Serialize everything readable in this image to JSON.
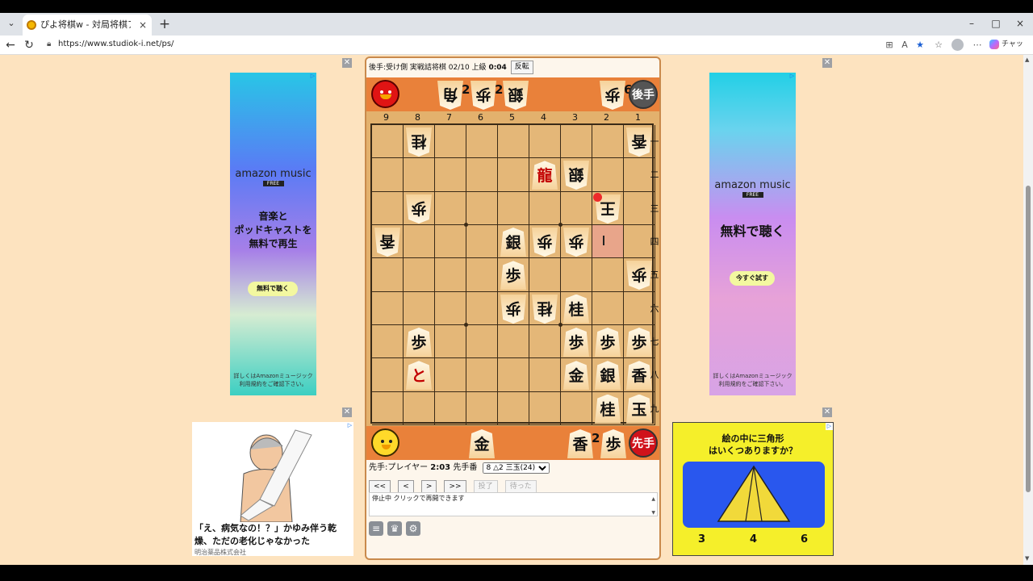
{
  "browser": {
    "tab_title": "ぴよ将棋w - 対局将棋アプリ WEB版",
    "tab_close": "×",
    "new_tab": "+",
    "url": "https://www.studiok-i.net/ps/",
    "copilot_label": "チャット",
    "icons": [
      "tab-list-icon",
      "back-icon",
      "reload-icon",
      "lock-icon",
      "app-icon",
      "read-aloud-icon",
      "favorite-star-icon",
      "favorites-icon",
      "profile-icon",
      "more-icon",
      "copilot-icon"
    ],
    "window_buttons": [
      "–",
      "□",
      "×"
    ]
  },
  "game": {
    "header": {
      "gote_info": "後手:受け側 実戦詰将棋 02/10 上級",
      "gote_time": "0:04",
      "flip_button": "反転"
    },
    "gote_hand": {
      "badge": "後手",
      "pieces": [
        {
          "kanji": "角",
          "count": "2"
        },
        {
          "kanji": "歩",
          "count": "2"
        },
        {
          "kanji": "銀",
          "count": ""
        },
        {
          "kanji": "歩",
          "count": "6"
        }
      ]
    },
    "sente_hand": {
      "badge": "先手",
      "pieces": [
        {
          "kanji": "金",
          "count": ""
        },
        {
          "kanji": "香",
          "count": "2"
        },
        {
          "kanji": "歩",
          "count": ""
        }
      ]
    },
    "files": [
      "9",
      "8",
      "7",
      "6",
      "5",
      "4",
      "3",
      "2",
      "1"
    ],
    "ranks": [
      "一",
      "二",
      "三",
      "四",
      "五",
      "六",
      "七",
      "八",
      "九"
    ],
    "pieces": [
      {
        "file": 8,
        "rank": 1,
        "kanji": "桂",
        "side": "gote"
      },
      {
        "file": 1,
        "rank": 1,
        "kanji": "香",
        "side": "gote"
      },
      {
        "file": 4,
        "rank": 2,
        "kanji": "龍",
        "side": "sente",
        "promoted": true
      },
      {
        "file": 3,
        "rank": 2,
        "kanji": "銀",
        "side": "gote"
      },
      {
        "file": 8,
        "rank": 3,
        "kanji": "歩",
        "side": "gote"
      },
      {
        "file": 2,
        "rank": 3,
        "kanji": "王",
        "side": "gote"
      },
      {
        "file": 9,
        "rank": 4,
        "kanji": "香",
        "side": "gote"
      },
      {
        "file": 5,
        "rank": 4,
        "kanji": "銀",
        "side": "sente"
      },
      {
        "file": 4,
        "rank": 4,
        "kanji": "歩",
        "side": "gote"
      },
      {
        "file": 3,
        "rank": 4,
        "kanji": "歩",
        "side": "gote"
      },
      {
        "file": 5,
        "rank": 5,
        "kanji": "歩",
        "side": "sente"
      },
      {
        "file": 1,
        "rank": 5,
        "kanji": "歩",
        "side": "gote"
      },
      {
        "file": 5,
        "rank": 6,
        "kanji": "歩",
        "side": "gote"
      },
      {
        "file": 4,
        "rank": 6,
        "kanji": "桂",
        "side": "gote"
      },
      {
        "file": 3,
        "rank": 6,
        "kanji": "桂",
        "side": "sente"
      },
      {
        "file": 8,
        "rank": 7,
        "kanji": "歩",
        "side": "sente"
      },
      {
        "file": 3,
        "rank": 7,
        "kanji": "歩",
        "side": "sente"
      },
      {
        "file": 2,
        "rank": 7,
        "kanji": "歩",
        "side": "sente"
      },
      {
        "file": 1,
        "rank": 7,
        "kanji": "歩",
        "side": "sente"
      },
      {
        "file": 8,
        "rank": 8,
        "kanji": "と",
        "side": "sente",
        "promoted": true
      },
      {
        "file": 3,
        "rank": 8,
        "kanji": "金",
        "side": "sente"
      },
      {
        "file": 2,
        "rank": 8,
        "kanji": "銀",
        "side": "sente"
      },
      {
        "file": 1,
        "rank": 8,
        "kanji": "香",
        "side": "sente"
      },
      {
        "file": 2,
        "rank": 9,
        "kanji": "桂",
        "side": "sente"
      },
      {
        "file": 1,
        "rank": 9,
        "kanji": "玉",
        "side": "sente"
      }
    ],
    "highlight_square": {
      "file": 2,
      "rank": 4
    },
    "last_move_square": {
      "file": 2,
      "rank": 3
    },
    "player": {
      "sente_info": "先手:プレイヤー",
      "sente_time": "2:03",
      "turn_label": "先手番",
      "move_select": "8 △2 三玉(24)"
    },
    "controls": [
      "<<",
      "<",
      ">",
      ">>",
      "投了",
      "待った"
    ],
    "message": "停止中 クリックで再開できます",
    "tool_icons": [
      "menu-icon",
      "trophy-icon",
      "settings-icon"
    ]
  },
  "ads": {
    "left": {
      "brand": "amazon music",
      "brand_sub": "FREE",
      "headline": "音楽と\nポッドキャストを\n無料で再生",
      "cta": "無料で聴く",
      "fine": "詳しくはAmazonミュージック\n利用規約をご確認下さい。"
    },
    "right": {
      "brand": "amazon music",
      "brand_sub": "FREE",
      "headline": "無料で聴く",
      "cta": "今すぐ試す",
      "fine": "詳しくはAmazonミュージック\n利用規約をご確認下さい。"
    },
    "bottom_left": {
      "copy": "「え、病気なの！？」かゆみ伴う乾燥、ただの老化じゃなかった",
      "advertiser": "明治薬品株式会社"
    },
    "bottom_right": {
      "question": "絵の中に三角形\nはいくつありますか？",
      "options": [
        "3",
        "4",
        "6"
      ]
    },
    "close_glyph": "✕",
    "badge_glyph": "▷"
  }
}
